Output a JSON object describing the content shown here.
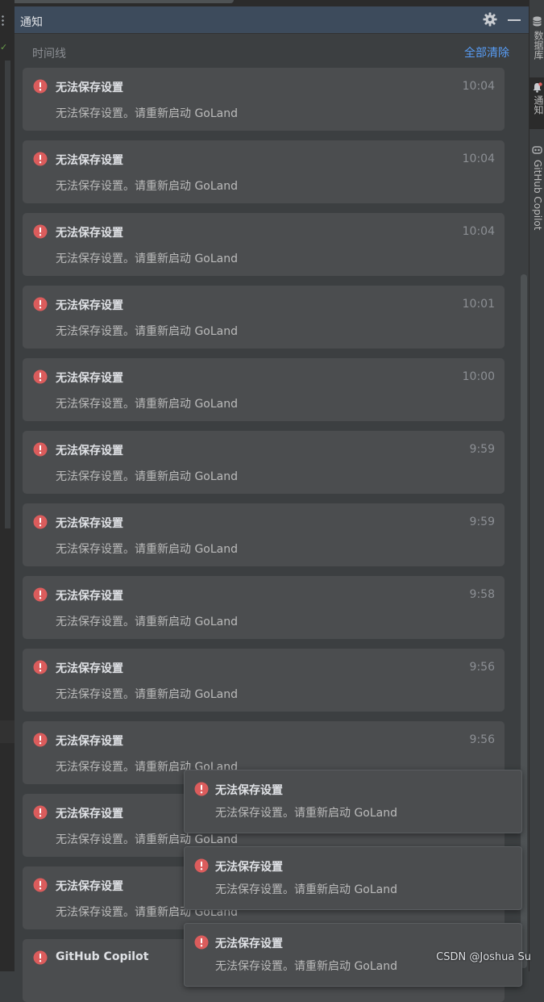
{
  "panel": {
    "title": "通知",
    "timeline_label": "时间线",
    "clear_all_label": "全部清除"
  },
  "notifications": [
    {
      "title": "无法保存设置",
      "time": "10:04",
      "message": "无法保存设置。请重新启动 GoLand"
    },
    {
      "title": "无法保存设置",
      "time": "10:04",
      "message": "无法保存设置。请重新启动 GoLand"
    },
    {
      "title": "无法保存设置",
      "time": "10:04",
      "message": "无法保存设置。请重新启动 GoLand"
    },
    {
      "title": "无法保存设置",
      "time": "10:01",
      "message": "无法保存设置。请重新启动 GoLand"
    },
    {
      "title": "无法保存设置",
      "time": "10:00",
      "message": "无法保存设置。请重新启动 GoLand"
    },
    {
      "title": "无法保存设置",
      "time": "9:59",
      "message": "无法保存设置。请重新启动 GoLand"
    },
    {
      "title": "无法保存设置",
      "time": "9:59",
      "message": "无法保存设置。请重新启动 GoLand"
    },
    {
      "title": "无法保存设置",
      "time": "9:58",
      "message": "无法保存设置。请重新启动 GoLand"
    },
    {
      "title": "无法保存设置",
      "time": "9:56",
      "message": "无法保存设置。请重新启动 GoLand"
    },
    {
      "title": "无法保存设置",
      "time": "9:56",
      "message": "无法保存设置。请重新启动 GoLand"
    },
    {
      "title": "无法保存设置",
      "time": "",
      "message": "无法保存设置。请重新启动 GoLand"
    },
    {
      "title": "无法保存设置",
      "time": "",
      "message": "无法保存设置。请重新启动 GoLand"
    },
    {
      "title": "GitHub Copilot",
      "time": "",
      "message": ""
    }
  ],
  "toasts": [
    {
      "title": "无法保存设置",
      "message": "无法保存设置。请重新启动 GoLand"
    },
    {
      "title": "无法保存设置",
      "message": "无法保存设置。请重新启动 GoLand"
    },
    {
      "title": "无法保存设置",
      "message": "无法保存设置。请重新启动 GoLand"
    }
  ],
  "right_toolbar": {
    "database_label": "数据库",
    "notifications_label": "通知",
    "copilot_label": "GitHub Copilot"
  },
  "watermark": "CSDN @Joshua Su",
  "colors": {
    "error": "#db5c5c",
    "link": "#589df6",
    "card": "#4b4d4f",
    "header": "#3d4b5c"
  }
}
